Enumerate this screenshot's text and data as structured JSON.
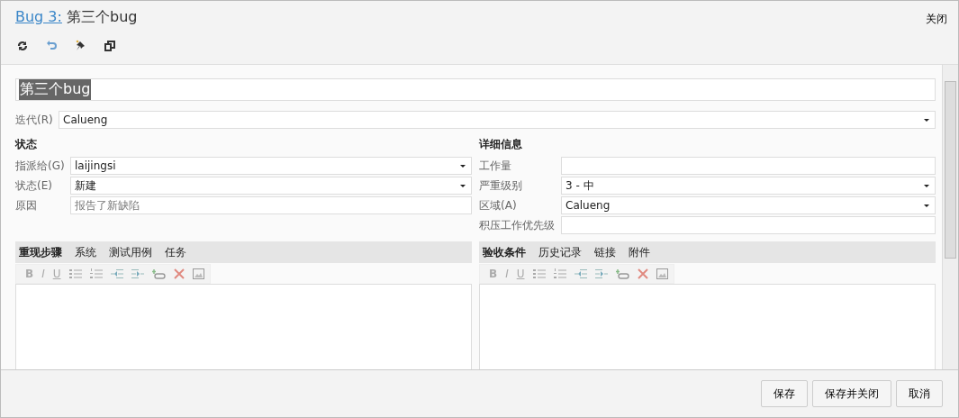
{
  "window": {
    "title_link": "Bug 3:",
    "title": "第三个bug",
    "close": "关闭"
  },
  "title_field": {
    "value": "第三个bug",
    "selected": true
  },
  "iteration": {
    "label": "迭代(R)",
    "value": "Calueng",
    "kind": "dropdown"
  },
  "left": {
    "heading": "状态",
    "fields": [
      {
        "label": "指派给(G)",
        "value": "laijingsi",
        "kind": "dropdown"
      },
      {
        "label": "状态(E)",
        "value": "新建",
        "kind": "dropdown"
      },
      {
        "label": "原因",
        "placeholder": "报告了新缺陷",
        "kind": "text"
      }
    ]
  },
  "right": {
    "heading": "详细信息",
    "fields": [
      {
        "label": "工作量",
        "kind": "text"
      },
      {
        "label": "严重级别",
        "value": "3 - 中",
        "kind": "dropdown"
      },
      {
        "label": "区域(A)",
        "value": "Calueng",
        "kind": "dropdown"
      },
      {
        "label": "积压工作优先级",
        "kind": "text"
      }
    ]
  },
  "left_tabs": [
    {
      "label": "重现步骤",
      "selected": true
    },
    {
      "label": "系统",
      "selected": false
    },
    {
      "label": "测试用例",
      "selected": false
    },
    {
      "label": "任务",
      "selected": false
    }
  ],
  "right_tabs": [
    {
      "label": "验收条件",
      "selected": true
    },
    {
      "label": "历史记录",
      "selected": false
    },
    {
      "label": "链接",
      "selected": false
    },
    {
      "label": "附件",
      "selected": false
    }
  ],
  "editor_toolbars": [
    {
      "bold": "B",
      "italic": "I",
      "underline": "U"
    },
    {
      "bold": "B",
      "italic": "I",
      "underline": "U"
    }
  ],
  "buttons": [
    "保存",
    "保存并关闭",
    "取消"
  ]
}
